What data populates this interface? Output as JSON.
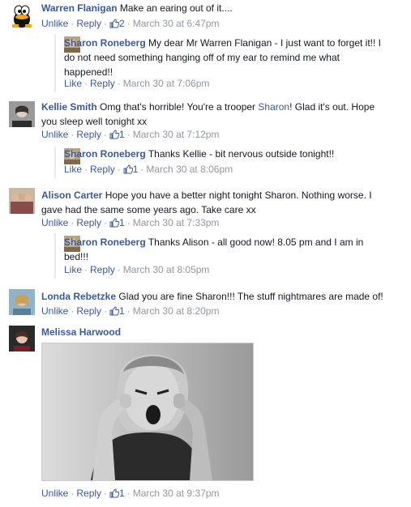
{
  "colors": {
    "link": "#3b5998",
    "meta": "#9197a3",
    "text": "#141823",
    "rail": "#e9eaed"
  },
  "comments": [
    {
      "author": "Warren Flanigan",
      "text": "Make an earing out of it....",
      "actions": {
        "a1": "Unlike",
        "a2": "Reply",
        "likes": "2",
        "time": "March 30 at 6:47pm"
      },
      "reply": {
        "author": "Sharon Roneberg",
        "text": "My dear Mr Warren Flanigan - I just want to forget it!! I do not need something hanging off of my ear to remind me what happened!!",
        "actions": {
          "a1": "Like",
          "a2": "Reply",
          "time": "March 30 at 7:06pm"
        }
      }
    },
    {
      "author": "Kellie Smith",
      "text_pre": "Omg that's horrible! You're a trooper",
      "mention": "Sharon",
      "text_post": "! Glad it's out. Hope you sleep well tonight xx",
      "actions": {
        "a1": "Unlike",
        "a2": "Reply",
        "likes": "1",
        "time": "March 30 at 7:12pm"
      },
      "reply": {
        "author": "Sharon Roneberg",
        "text": "Thanks Kellie - bit nervous outside tonight!!",
        "actions": {
          "a1": "Like",
          "a2": "Reply",
          "likes": "1",
          "time": "March 30 at 8:06pm"
        }
      }
    },
    {
      "author": "Alison Carter",
      "text": "Hope you have a better night tonight Sharon. Nothing worse. I gave had the same some years ago. Take care xx",
      "actions": {
        "a1": "Unlike",
        "a2": "Reply",
        "likes": "1",
        "time": "March 30 at 7:33pm"
      },
      "reply": {
        "author": "Sharon Roneberg",
        "text": "Thanks Alison - all good now! 8.05 pm and I am in bed!!!",
        "actions": {
          "a1": "Like",
          "a2": "Reply",
          "time": "March 30 at 8:05pm"
        }
      }
    },
    {
      "author": "Londa Rebetzke",
      "text": "Glad you are fine Sharon!!! The stuff nightmares are made of!",
      "actions": {
        "a1": "Unlike",
        "a2": "Reply",
        "likes": "1",
        "time": "March 30 at 8:20pm"
      }
    },
    {
      "author": "Melissa Harwood",
      "photo_icon": "photo-woman-covering-ears",
      "actions": {
        "a1": "Unlike",
        "a2": "Reply",
        "likes": "1",
        "time": "March 30 at 9:37pm"
      }
    }
  ]
}
